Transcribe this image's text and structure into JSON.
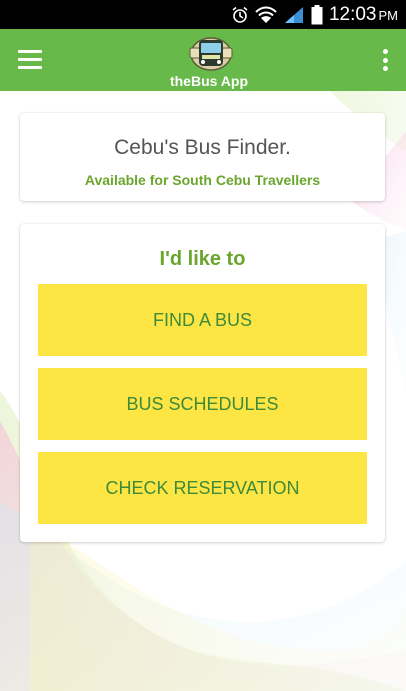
{
  "status_bar": {
    "time": "12:03",
    "ampm": "PM",
    "icons": [
      "alarm-icon",
      "wifi-icon",
      "signal-icon",
      "battery-icon"
    ]
  },
  "app_bar": {
    "title": "theBus App",
    "logo_icon": "bus-logo-icon",
    "menu_icon": "hamburger-menu-icon",
    "overflow_icon": "more-vert-icon",
    "color": "#67b94a"
  },
  "finder_card": {
    "title": "Cebu's Bus Finder.",
    "subtitle": "Available for South Cebu Travellers"
  },
  "actions_card": {
    "heading": "I'd like to",
    "buttons": [
      {
        "label": "FIND A BUS"
      },
      {
        "label": "BUS SCHEDULES"
      },
      {
        "label": "CHECK RESERVATION"
      }
    ],
    "button_color": "#fde544",
    "button_text_color": "#3d8b3a"
  }
}
